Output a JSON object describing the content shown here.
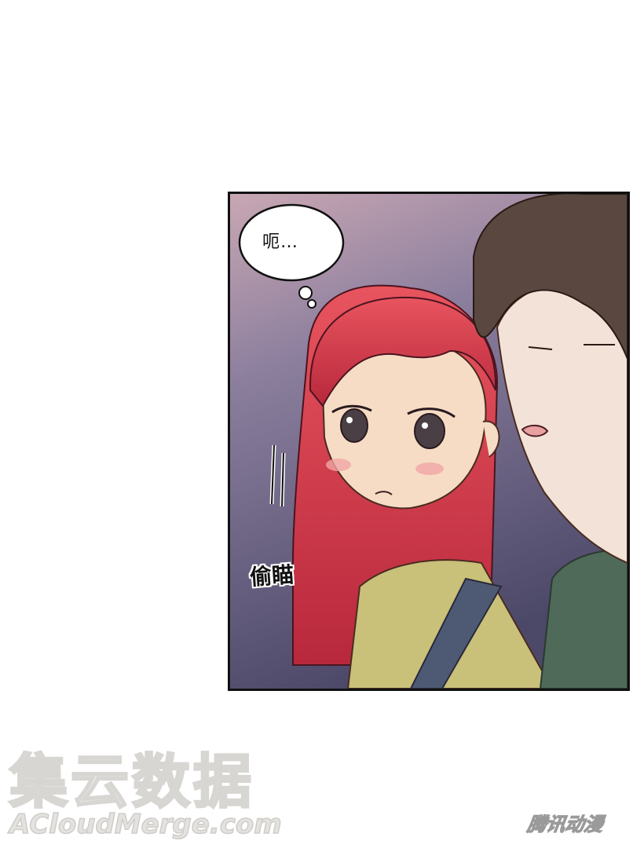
{
  "panel": {
    "speech_bubble_text": "呃…",
    "sound_effect_text": "偷瞄"
  },
  "watermark": {
    "site_cn": "集云数据",
    "site_en": "ACloudMerge.com",
    "publisher_logo": "腾讯动漫"
  }
}
